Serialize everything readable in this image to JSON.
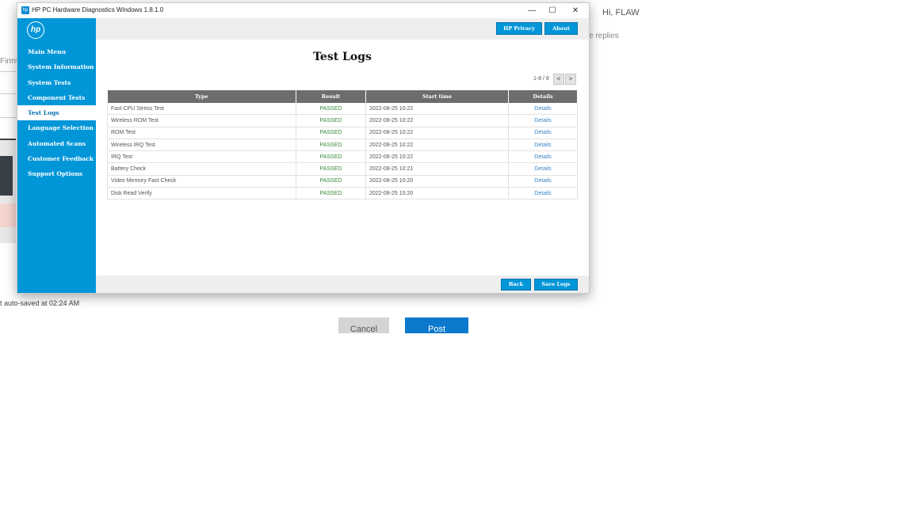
{
  "background": {
    "avatar_letter": "",
    "greeting": "Hi, FLAW",
    "replies_text": "e replies",
    "firmware_text": "Firmw",
    "autosave_text": "t auto-saved at 02:24 AM",
    "cancel_label": "Cancel",
    "post_label": "Post"
  },
  "window": {
    "app_icon": "hp",
    "title": "HP PC Hardware Diagnostics Windows 1.8.1.0",
    "minimize": "—",
    "maximize": "☐",
    "close": "✕"
  },
  "sidebar": {
    "logo": "hp",
    "items": [
      {
        "label": "Main Menu",
        "active": false
      },
      {
        "label": "System Information",
        "active": false
      },
      {
        "label": "System Tests",
        "active": false
      },
      {
        "label": "Component Tests",
        "active": false
      },
      {
        "label": "Test Logs",
        "active": true
      },
      {
        "label": "Language Selection",
        "active": false
      },
      {
        "label": "Automated Scans",
        "active": false
      },
      {
        "label": "Customer Feedback",
        "active": false
      },
      {
        "label": "Support Options",
        "active": false
      }
    ]
  },
  "header": {
    "privacy_label": "HP Privacy",
    "about_label": "About"
  },
  "main": {
    "title": "Test Logs",
    "pager_text": "1-8 / 8",
    "prev": "<",
    "next": ">",
    "columns": [
      "Type",
      "Result",
      "Start time",
      "Details"
    ],
    "rows": [
      {
        "type": "Fast CPU Stress Test",
        "result": "PASSED",
        "start": "2022-08-25 10:22",
        "details": "Details"
      },
      {
        "type": "Wireless ROM Test",
        "result": "PASSED",
        "start": "2022-08-25 10:22",
        "details": "Details"
      },
      {
        "type": "ROM Test",
        "result": "PASSED",
        "start": "2022-08-25 10:22",
        "details": "Details"
      },
      {
        "type": "Wireless IRQ Test",
        "result": "PASSED",
        "start": "2022-08-25 10:22",
        "details": "Details"
      },
      {
        "type": "IRQ Test",
        "result": "PASSED",
        "start": "2022-08-25 10:22",
        "details": "Details"
      },
      {
        "type": "Battery Check",
        "result": "PASSED",
        "start": "2022-08-25 10:21",
        "details": "Details"
      },
      {
        "type": "Video Memory Fast Check",
        "result": "PASSED",
        "start": "2022-08-25 10:20",
        "details": "Details"
      },
      {
        "type": "Disk Read Verify",
        "result": "PASSED",
        "start": "2022-08-25 10:20",
        "details": "Details"
      }
    ]
  },
  "footer": {
    "back_label": "Back",
    "save_label": "Save Logs"
  },
  "colors": {
    "accent": "#0196d8",
    "header_gray": "#6d6d6d",
    "passed": "#3a8a3a",
    "link": "#3a86c6"
  }
}
